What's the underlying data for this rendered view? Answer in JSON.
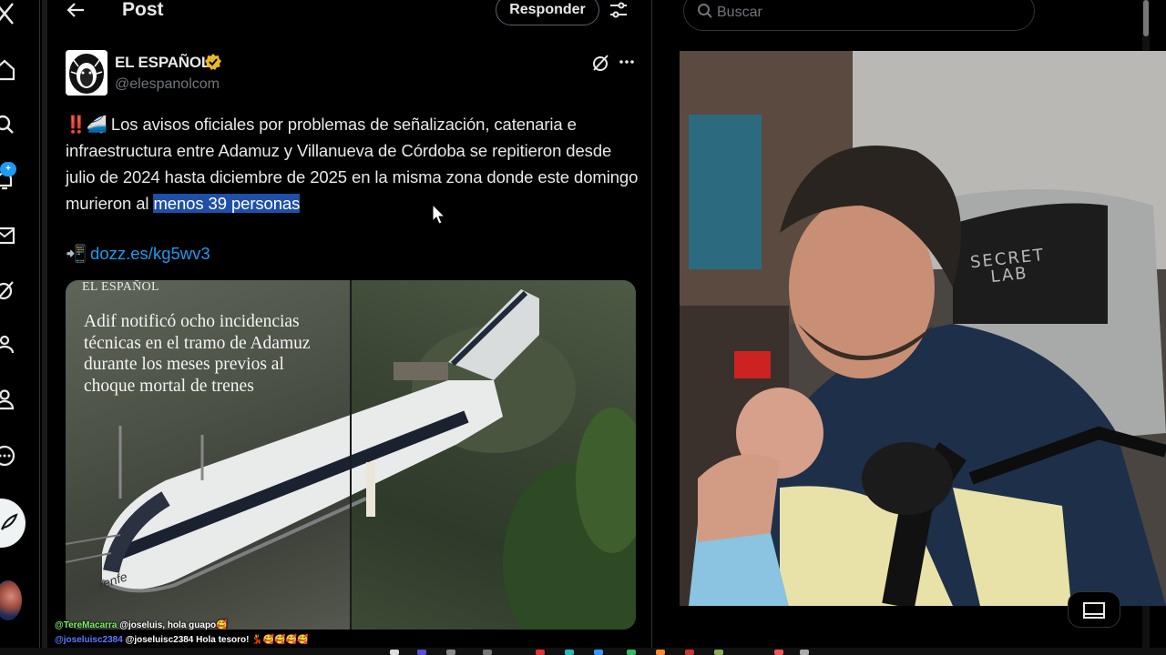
{
  "header": {
    "title": "Post",
    "reply_label": "Responder"
  },
  "nav": {
    "notifications_badge": "+"
  },
  "post": {
    "author_name": "EL ESPAÑOL",
    "author_handle": "@elespanolcom",
    "text_prefix_emoji": "‼️🚄",
    "text_main": "Los avisos oficiales por problemas de señalización, catenaria e infraestructura entre Adamuz y Villanueva de Córdoba se repitieron desde julio de 2024 hasta diciembre de 2025 en la misma zona donde este domingo murieron al ",
    "text_highlight": "menos 39 personas",
    "link_emoji": "📲",
    "link_text": "dozz.es/kg5wv3",
    "media_brand": "EL ESPAÑOL",
    "media_headline": "Adif notificó ocho incidencias técnicas en el tramo de Adamuz durante los meses previos al choque mortal de trenes",
    "train_logo": "renfe"
  },
  "search": {
    "placeholder": "Buscar"
  },
  "webcam": {
    "chair_brand_line1": "SECRET",
    "chair_brand_line2": "LAB"
  },
  "chat": [
    {
      "user": "@TereMacarra",
      "message": "@joseluis, hola guapo🥰"
    },
    {
      "user": "@joseluisc2384",
      "message": "@joseluisc2384 Hola tesoro! 💃🥰🥰🥰🥰"
    }
  ],
  "colors": {
    "accent": "#1d9bf0",
    "highlight": "#1f4fa8",
    "verified": "#e8b923",
    "background": "#000000"
  }
}
